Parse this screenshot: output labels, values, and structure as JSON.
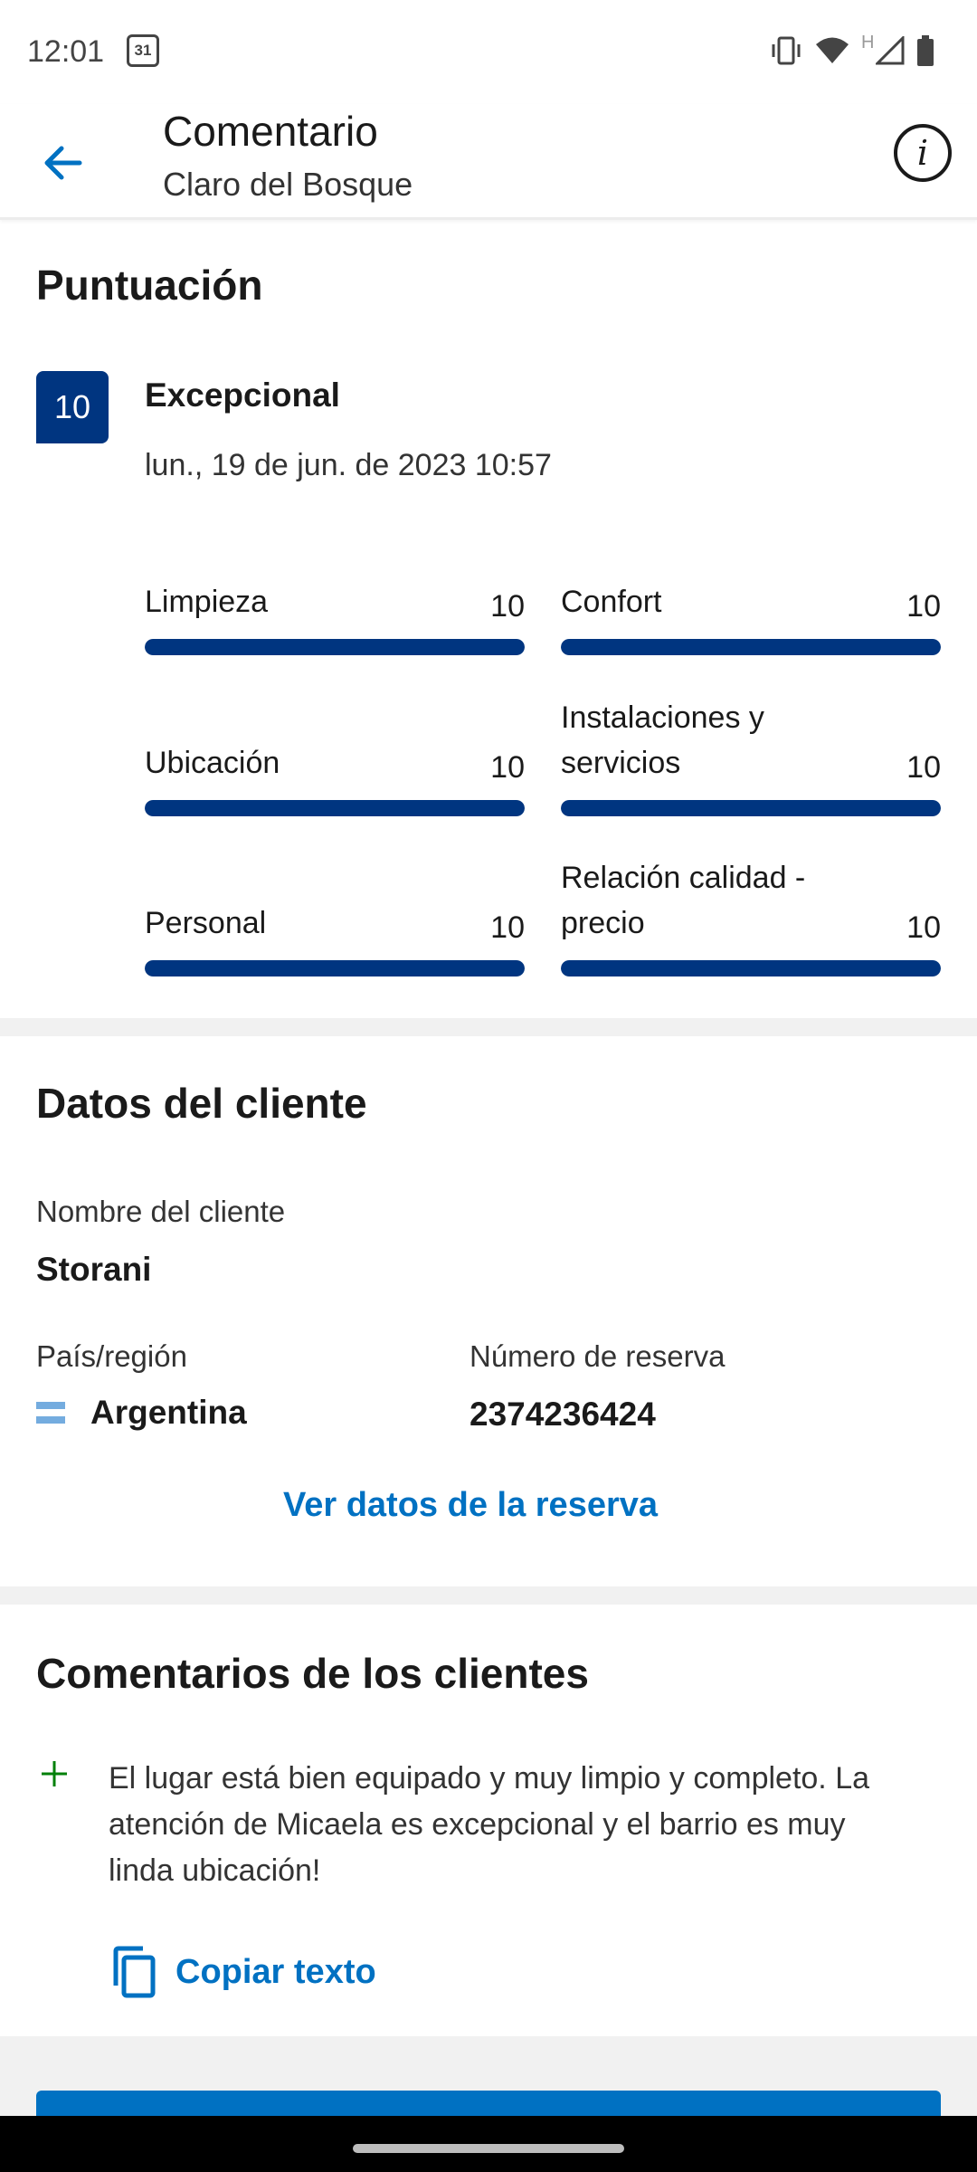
{
  "status_bar": {
    "time": "12:01",
    "calendar_day": "31",
    "network_label": "H",
    "icons": [
      "vibrate-icon",
      "wifi-icon",
      "signal-icon",
      "battery-icon"
    ]
  },
  "app_bar": {
    "title": "Comentario",
    "subtitle": "Claro del Bosque",
    "info_glyph": "i"
  },
  "score": {
    "heading": "Puntuación",
    "value": "10",
    "word": "Excepcional",
    "date": "lun., 19 de jun. de 2023 10:57",
    "categories": [
      {
        "label": "Limpieza",
        "value": "10",
        "fraction": 1.0
      },
      {
        "label": "Confort",
        "value": "10",
        "fraction": 1.0
      },
      {
        "label": "Ubicación",
        "value": "10",
        "fraction": 1.0
      },
      {
        "label": "Instalaciones y servicios",
        "value": "10",
        "fraction": 1.0
      },
      {
        "label": "Personal",
        "value": "10",
        "fraction": 1.0
      },
      {
        "label": "Relación calidad - precio",
        "value": "10",
        "fraction": 1.0
      }
    ]
  },
  "client": {
    "heading": "Datos del cliente",
    "name_label": "Nombre del cliente",
    "name": "Storani",
    "country_label": "País/región",
    "country": "Argentina",
    "booking_label": "Número de reserva",
    "booking_number": "2374236424",
    "view_booking_link": "Ver datos de la reserva"
  },
  "reviews": {
    "heading": "Comentarios de los clientes",
    "positive_text": "El lugar está bien equipado y muy limpio y completo. La atención de Micaela es excepcional y el barrio es muy linda ubicación!",
    "copy_label": "Copiar texto"
  },
  "colors": {
    "brand_dark": "#003580",
    "link_blue": "#0071c2",
    "positive_green": "#008009"
  }
}
